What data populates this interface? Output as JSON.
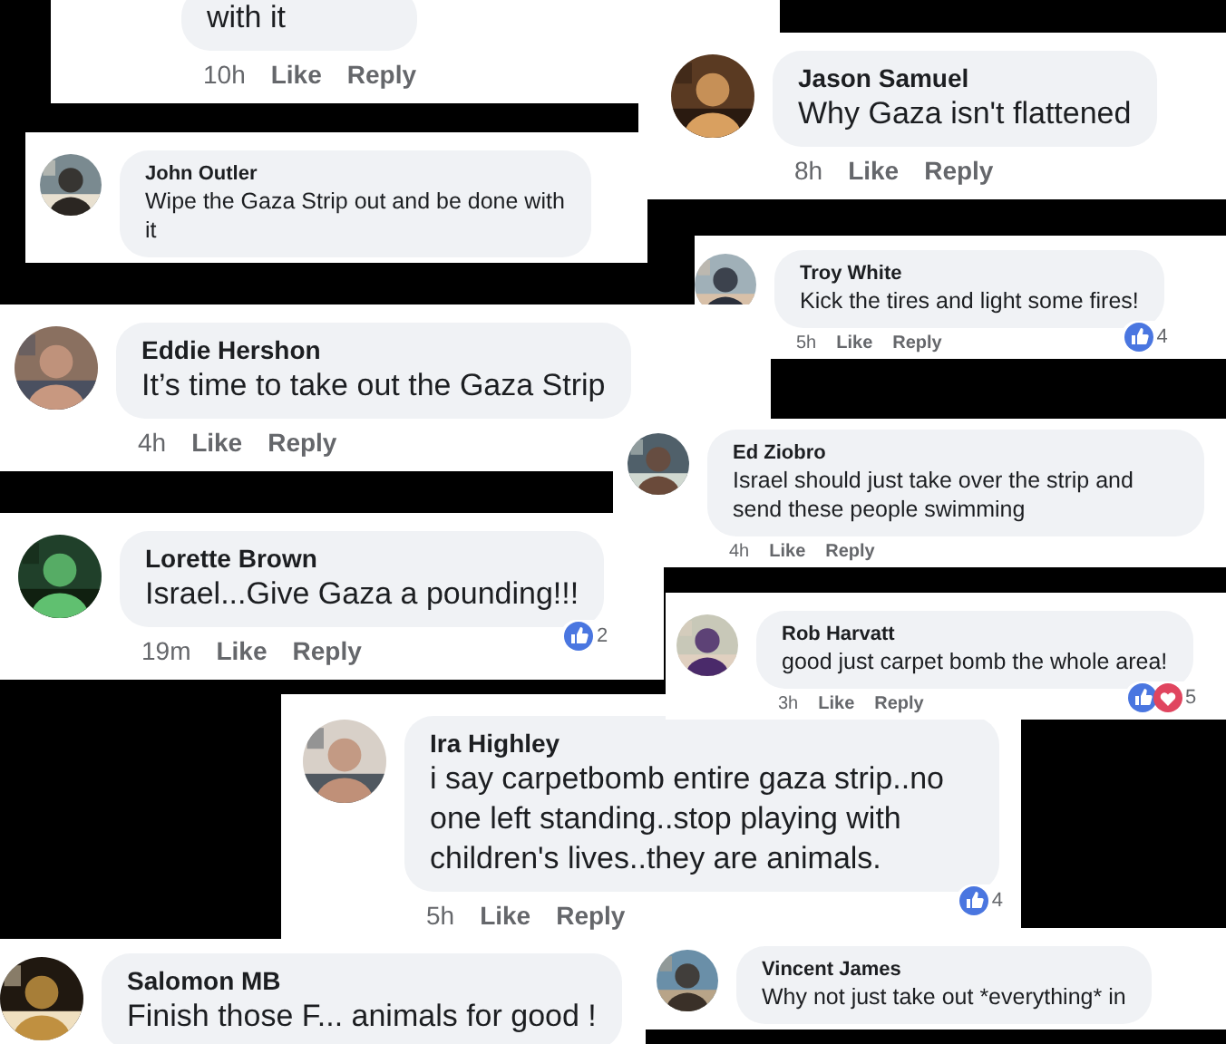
{
  "comments": [
    {
      "text": "with it",
      "time": "10h",
      "like": "Like",
      "reply": "Reply"
    },
    {
      "name": "Jason Samuel",
      "text": "Why Gaza isn't flattened",
      "time": "8h",
      "like": "Like",
      "reply": "Reply"
    },
    {
      "name": "John Outler",
      "text": "Wipe the Gaza Strip out and be done with it"
    },
    {
      "name": "Troy White",
      "text": "Kick the tires and light some fires!",
      "time": "5h",
      "like": "Like",
      "reply": "Reply",
      "reactions": {
        "icons": [
          {
            "kind": "like"
          }
        ],
        "count": "4"
      }
    },
    {
      "name": "Eddie Hershon",
      "text": "It’s time to take out the Gaza Strip",
      "time": "4h",
      "like": "Like",
      "reply": "Reply"
    },
    {
      "name": "Ed Ziobro",
      "text": "Israel should just take over the strip and send these people swimming",
      "time": "4h",
      "like": "Like",
      "reply": "Reply"
    },
    {
      "name": "Lorette Brown",
      "text": "Israel...Give Gaza a pounding!!!",
      "time": "19m",
      "like": "Like",
      "reply": "Reply",
      "reactions": {
        "icons": [
          {
            "kind": "like"
          }
        ],
        "count": "2"
      }
    },
    {
      "name": "Rob Harvatt",
      "text": "good just carpet bomb the whole area!",
      "time": "3h",
      "like": "Like",
      "reply": "Reply",
      "reactions": {
        "icons": [
          {
            "kind": "like"
          },
          {
            "kind": "love"
          }
        ],
        "count": "5"
      }
    },
    {
      "name": "Ira Highley",
      "text": "i say carpetbomb entire gaza strip..no one left standing..stop playing with children's lives..they are animals.",
      "time": "5h",
      "like": "Like",
      "reply": "Reply",
      "reactions": {
        "icons": [
          {
            "kind": "like"
          }
        ],
        "count": "4"
      }
    },
    {
      "name": "Salomon MB",
      "text": "Finish those F... animals for good !"
    },
    {
      "name": "Vincent James",
      "text": "Why not just take out *everything* in"
    }
  ]
}
